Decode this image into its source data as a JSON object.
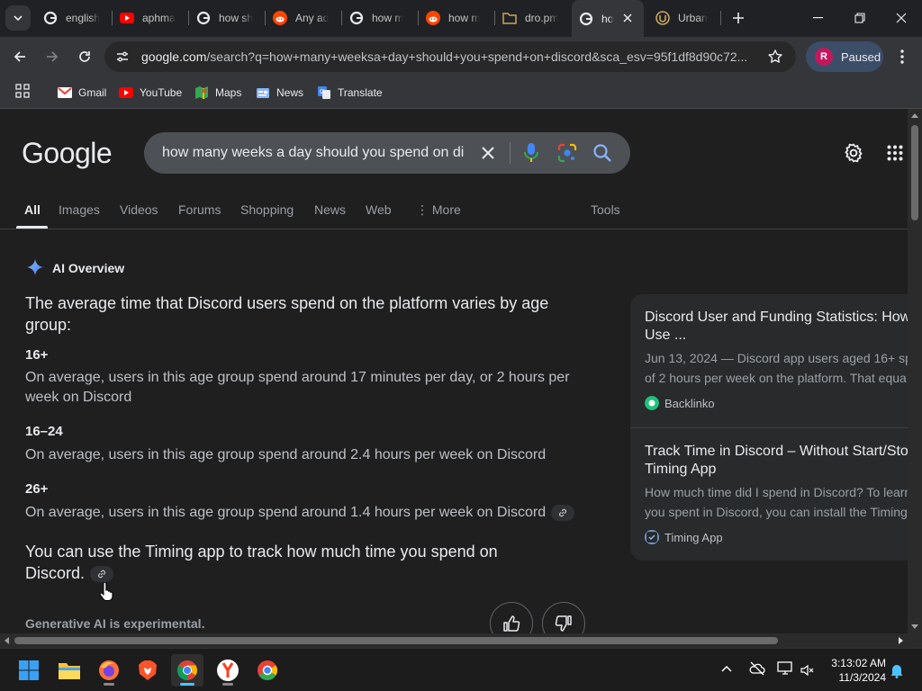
{
  "browser": {
    "tabs": [
      {
        "title": "english",
        "icon": "google-icon"
      },
      {
        "title": "aphma",
        "icon": "youtube-icon"
      },
      {
        "title": "how sh",
        "icon": "google-icon"
      },
      {
        "title": "Any ad",
        "icon": "reddit-icon"
      },
      {
        "title": "how m",
        "icon": "google-icon"
      },
      {
        "title": "how m",
        "icon": "reddit-icon"
      },
      {
        "title": "dro.pm",
        "icon": "dro-icon"
      },
      {
        "title": "ho",
        "icon": "google-icon",
        "active": true
      },
      {
        "title": "Urban",
        "icon": "urban-icon"
      }
    ],
    "url_host": "google.com",
    "url_rest": "/search?q=how+many+weeksa+day+should+you+spend+on+discord&sca_esv=95f1df8d90c72...",
    "profile": {
      "initial": "R",
      "label": "Paused"
    },
    "bookmarks": [
      {
        "label": "Gmail",
        "icon": "gmail-icon"
      },
      {
        "label": "YouTube",
        "icon": "youtube-icon"
      },
      {
        "label": "Maps",
        "icon": "maps-icon"
      },
      {
        "label": "News",
        "icon": "news-icon"
      },
      {
        "label": "Translate",
        "icon": "translate-icon"
      }
    ]
  },
  "google": {
    "logo": "Google",
    "query": "how many weeks a day should you spend on di",
    "tabs": [
      "All",
      "Images",
      "Videos",
      "Forums",
      "Shopping",
      "News",
      "Web",
      "More",
      "Tools"
    ],
    "active_tab": "All"
  },
  "ai_overview": {
    "heading": "AI Overview",
    "intro": "The average time that Discord users spend on the platform varies by age group:",
    "groups": [
      {
        "label": "16+",
        "text": "On average, users in this age group spend around 17 minutes per day, or 2 hours per week on Discord"
      },
      {
        "label": "16–24",
        "text": "On average, users in this age group spend around 2.4 hours per week on Discord"
      },
      {
        "label": "26+",
        "text": "On average, users in this age group spend around 1.4 hours per week on Discord"
      }
    ],
    "tip": "You can use the Timing app to track how much time you spend on Discord.",
    "footer": "Generative AI is experimental."
  },
  "sources": [
    {
      "title": "Discord User and Funding Statistics: How Use ...",
      "snippet_line1": "Jun 13, 2024 — Discord app users aged 16+ sp",
      "snippet_line2": "of 2 hours per week on the platform. That equa",
      "site": "Backlinko"
    },
    {
      "title": "Track Time in Discord – Without Start/Sto Timing App",
      "snippet_line1": "How much time did I spend in Discord? To learn",
      "snippet_line2": "you spent in Discord, you can install the Timing",
      "site": "Timing App"
    }
  ],
  "taskbar": {
    "apps": [
      "windows-start-icon",
      "file-explorer-icon",
      "firefox-icon",
      "brave-icon",
      "chrome-icon",
      "yandex-icon",
      "chromium-icon"
    ],
    "time": "3:13:02 AM",
    "date": "11/3/2024"
  },
  "colors": {
    "accent": "#8ab4f8",
    "page_bg": "#1f1f1f",
    "profile_bg": "#3c4d68"
  }
}
